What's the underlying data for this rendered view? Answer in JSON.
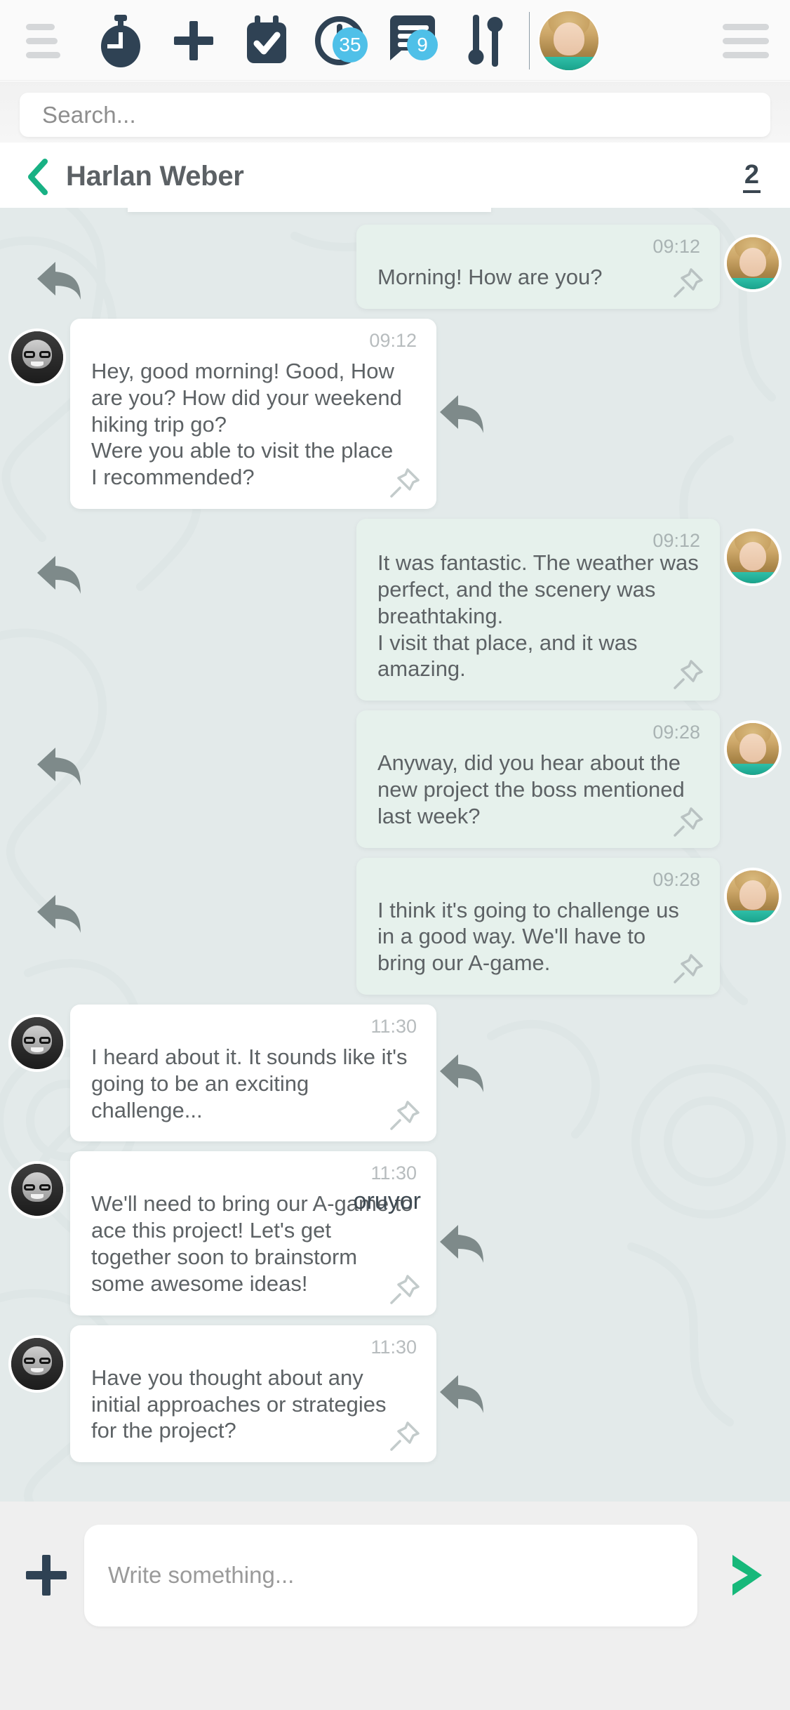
{
  "topbar": {
    "menu_left_icon": "hamburger-icon",
    "menu_right_icon": "hamburger-icon",
    "actions": [
      {
        "name": "timer-icon",
        "badge": null
      },
      {
        "name": "plus-icon",
        "badge": null
      },
      {
        "name": "calendar-check-icon",
        "badge": null
      },
      {
        "name": "clock-icon",
        "badge": "35"
      },
      {
        "name": "chat-icon",
        "badge": "9"
      },
      {
        "name": "sliders-icon",
        "badge": null
      }
    ],
    "badge_color": "#4fc0e8",
    "icon_color": "#2f4254",
    "avatar_alt": "user-avatar"
  },
  "search": {
    "placeholder": "Search..."
  },
  "chat_header": {
    "back_icon": "chevron-left-icon",
    "back_icon_color": "#18b184",
    "title": "Harlan Weber",
    "count": "2"
  },
  "conversation": {
    "messages": [
      {
        "side": "out",
        "time": "09:12",
        "text": "Morning! How are you?",
        "avatar": "woman",
        "pin_icon": "pin-icon",
        "reply_icon": "reply-arrow-icon"
      },
      {
        "side": "in",
        "time": "09:12",
        "text": "Hey, good morning! Good, How are you? How did your weekend hiking trip go?\nWere you able to visit the place\nI recommended?",
        "avatar": "man",
        "pin_icon": "pin-icon",
        "reply_icon": "reply-arrow-icon"
      },
      {
        "side": "out",
        "time": "09:12",
        "text": "It was fantastic. The weather was perfect, and the scenery was breathtaking.\nI visit that place, and it was amazing.",
        "avatar": "woman",
        "pin_icon": "pin-icon",
        "reply_icon": "reply-arrow-icon"
      },
      {
        "side": "out",
        "time": "09:28",
        "text": "Anyway, did you hear about the new project the boss mentioned last week?",
        "avatar": "woman",
        "pin_icon": "pin-icon",
        "reply_icon": "reply-arrow-icon"
      },
      {
        "side": "out",
        "time": "09:28",
        "text": "I think it's going to challenge us in a good way. We'll have to bring our A-game.",
        "avatar": "woman",
        "pin_icon": "pin-icon",
        "reply_icon": "reply-arrow-icon"
      },
      {
        "side": "in",
        "time": "11:30",
        "text": "I heard about it. It sounds like it's going to be an exciting challenge...",
        "avatar": "man",
        "pin_icon": "pin-icon",
        "reply_icon": "reply-arrow-icon"
      },
      {
        "side": "in",
        "time": "11:30",
        "text": "We'll need to bring our A-game to ace this project! Let's get together soon to brainstorm some awesome ideas!",
        "avatar": "man",
        "pin_icon": "pin-icon",
        "reply_icon": "reply-arrow-icon",
        "overlay_text": "oruyor"
      },
      {
        "side": "in",
        "time": "11:30",
        "text": "Have you thought about any initial approaches or strategies for the project?",
        "avatar": "man",
        "pin_icon": "pin-icon",
        "reply_icon": "reply-arrow-icon"
      }
    ]
  },
  "composer": {
    "add_icon": "plus-icon",
    "placeholder": "Write something...",
    "send_icon": "send-icon",
    "send_color": "#17b87a"
  }
}
